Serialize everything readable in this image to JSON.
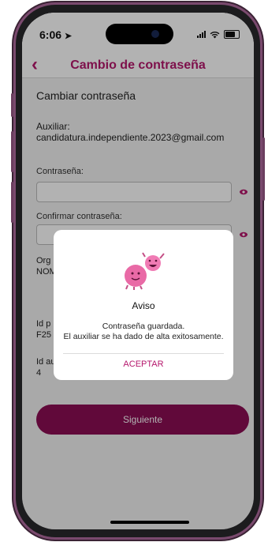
{
  "status_bar": {
    "time": "6:06"
  },
  "header": {
    "back_icon": "chevron-left-icon",
    "title": "Cambio de contraseña"
  },
  "form": {
    "section_title": "Cambiar contraseña",
    "auxiliar_label": "Auxiliar:",
    "auxiliar_email": "candidatura.independiente.2023@gmail.com",
    "password_label": "Contraseña:",
    "password_value": "",
    "confirm_label": "Confirmar contraseña:",
    "confirm_value": "",
    "org_label_partial": "Org",
    "org_value_partial": "NOM",
    "id_p_label_partial": "Id p",
    "id_p_value_partial": "F25",
    "id_au_label_partial": "Id au",
    "id_au_value": "4",
    "next_button": "Siguiente"
  },
  "dialog": {
    "title": "Aviso",
    "message_line1": "Contraseña guardada.",
    "message_line2": "El auxiliar se ha dado de alta exitosamente.",
    "accept_button": "ACEPTAR"
  },
  "colors": {
    "brand_magenta": "#b5176c",
    "button_dark": "#8b0d53"
  }
}
